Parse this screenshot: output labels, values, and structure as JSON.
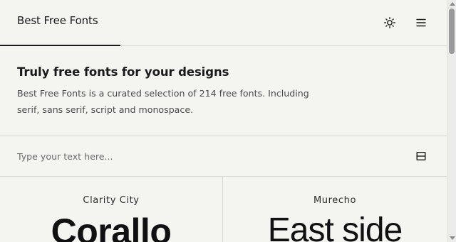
{
  "header": {
    "brand": "Best Free Fonts",
    "theme_icon": "sun-icon",
    "menu_icon": "hamburger-menu-icon"
  },
  "intro": {
    "heading": "Truly free fonts for your designs",
    "description": "Best Free Fonts is a curated selection of 214 free fonts. Including serif, sans serif, script and monospace."
  },
  "text_input": {
    "placeholder": "Type your text here...",
    "value": "",
    "layout_icon": "layout-toggle-icon"
  },
  "fonts": [
    {
      "name": "Clarity City",
      "sample": "Corallo"
    },
    {
      "name": "Murecho",
      "sample": "East side"
    }
  ],
  "colors": {
    "background": "#f4f4f1",
    "text": "#1a1a1a",
    "muted_text": "#4a4a4a",
    "divider": "#d8d8d4"
  }
}
